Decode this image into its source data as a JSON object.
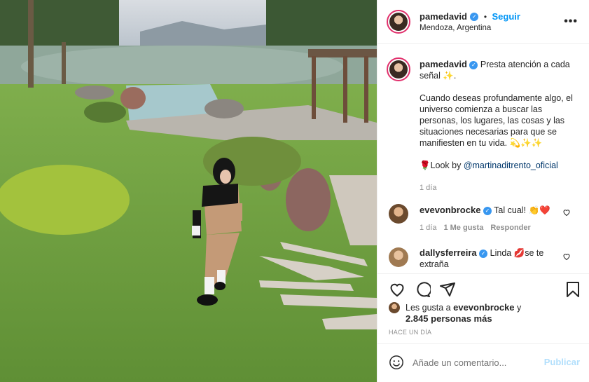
{
  "post": {
    "username": "pamedavid",
    "location": "Mendoza, Argentina",
    "follow_label": "Seguir",
    "more_label": "•••"
  },
  "caption": {
    "username": "pamedavid",
    "line1": "Presta atención a cada señal ✨.",
    "line2": "Cuando deseas profundamente algo, el universo comienza a buscar las personas, los lugares, las cosas y las situaciones necesarias para que se manifiesten en tu vida. 💫✨✨",
    "look_prefix": "🌹Look by ",
    "look_mention": "@martinaditrento_oficial",
    "time": "1 día"
  },
  "comments": [
    {
      "username": "evevonbrocke",
      "text": "Tal cual! 👏❤️",
      "time": "1 día",
      "likes": "1 Me gusta",
      "reply": "Responder"
    },
    {
      "username": "dallysferreira",
      "text": "Linda 💋se te extraña",
      "time": "",
      "likes": "",
      "reply": ""
    }
  ],
  "likes": {
    "prefix": "Les gusta a ",
    "user": "evevonbrocke",
    "suffix": " y",
    "count": "2.845 personas más",
    "time": "HACE UN DÍA"
  },
  "add_comment": {
    "placeholder": "Añade un comentario...",
    "publish_label": "Publicar"
  },
  "colors": {
    "accent": "#0095f6",
    "publish_disabled": "#b2dffc",
    "text": "#262626",
    "muted": "#8e8e8e"
  }
}
